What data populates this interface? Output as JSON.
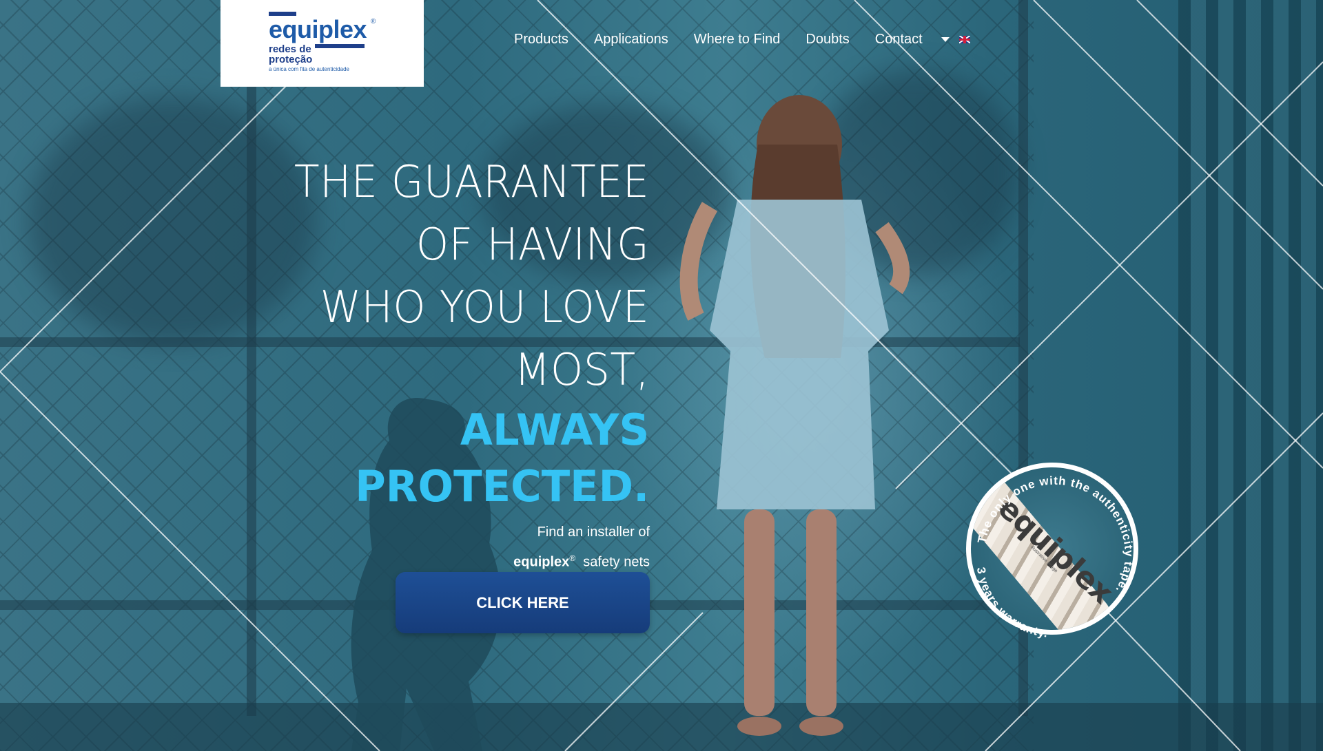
{
  "logo": {
    "brand": "equiplex",
    "registered": "®",
    "subtitle": "redes de proteção",
    "tagline": "a única com fita de autenticidade"
  },
  "nav": {
    "items": [
      "Products",
      "Applications",
      "Where to Find",
      "Doubts",
      "Contact"
    ],
    "language_icon": "uk-flag-icon"
  },
  "hero": {
    "headline_lines": [
      "THE GUARANTEE",
      "OF HAVING",
      "WHO YOU LOVE",
      "MOST,"
    ],
    "highlight_lines": [
      "ALWAYS",
      "PROTECTED"
    ],
    "highlight_period": ".",
    "find_line1": "Find an installer of",
    "find_brand": "equiplex",
    "find_reg": "®",
    "find_suffix": "safety nets",
    "cta_label": "CLICK HERE"
  },
  "badge": {
    "arc_text": "The only one with the authenticity tape.",
    "bottom_text": "3 years warranty.",
    "rope_text": "equiplex",
    "illustrative_note": "illustrative image"
  },
  "colors": {
    "accent": "#35c3f4",
    "cta": "#1e4f96",
    "logo_blue": "#1e5ba8"
  }
}
